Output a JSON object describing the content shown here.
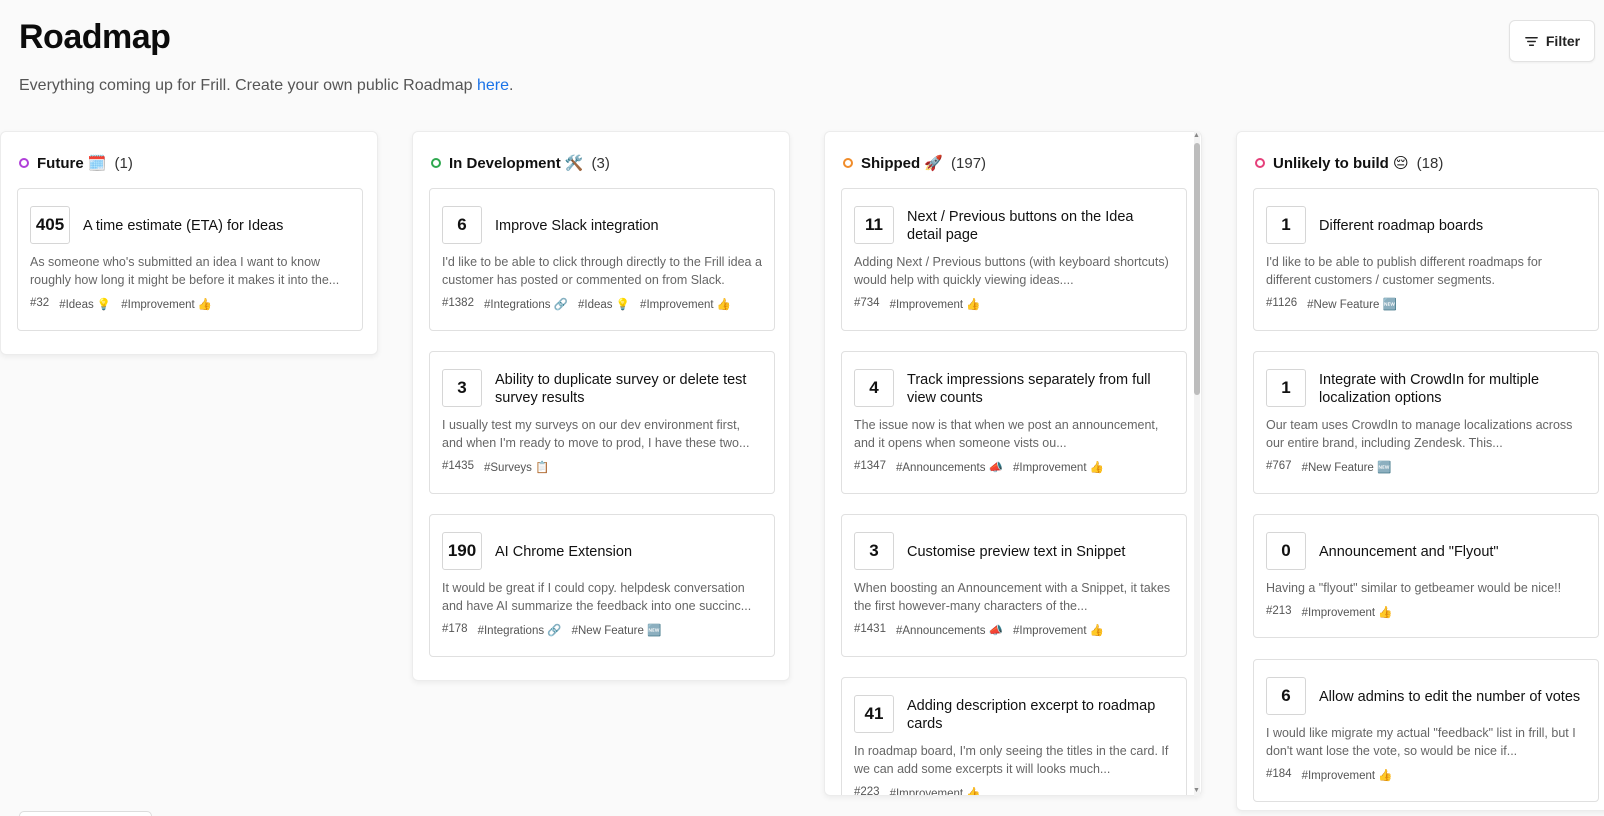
{
  "header": {
    "title": "Roadmap",
    "subtitle_prefix": "Everything coming up for Frill. Create your own public Roadmap ",
    "subtitle_link": "here",
    "subtitle_suffix": ".",
    "filter_label": "Filter"
  },
  "colors": {
    "future": "#b03fd9",
    "in_development": "#2fa84f",
    "shipped": "#f08c2a",
    "unlikely": "#e5407a",
    "link": "#1a73e8"
  },
  "columns": [
    {
      "title": "Future 🗓️",
      "count": "(1)",
      "cards": [
        {
          "votes": "405",
          "title": "A time estimate (ETA) for Ideas",
          "desc": "As someone who's submitted an idea I want to know roughly how long it might be before it makes it into the...",
          "tags": [
            "#32",
            "#Ideas 💡",
            "#Improvement 👍"
          ]
        }
      ]
    },
    {
      "title": "In Development 🛠️",
      "count": "(3)",
      "cards": [
        {
          "votes": "6",
          "title": "Improve Slack integration",
          "desc": "I'd like to be able to click through directly to the Frill idea a customer has posted or commented on from Slack.",
          "tags": [
            "#1382",
            "#Integrations 🔗",
            "#Ideas 💡",
            "#Improvement 👍"
          ]
        },
        {
          "votes": "3",
          "title": "Ability to duplicate survey or delete test survey results",
          "desc": "I usually test my surveys on our dev environment first, and when I'm ready to move to prod, I have these two...",
          "tags": [
            "#1435",
            "#Surveys 📋"
          ]
        },
        {
          "votes": "190",
          "title": "AI Chrome Extension",
          "desc": "It would be great if I could copy. helpdesk conversation and have AI summarize the feedback into one succinc...",
          "tags": [
            "#178",
            "#Integrations 🔗",
            "#New Feature 🆕"
          ]
        }
      ]
    },
    {
      "title": "Shipped 🚀",
      "count": "(197)",
      "cards": [
        {
          "votes": "11",
          "title": "Next / Previous buttons on the Idea detail page",
          "desc": "Adding Next / Previous buttons (with keyboard shortcuts) would help with quickly viewing ideas....",
          "tags": [
            "#734",
            "#Improvement 👍"
          ]
        },
        {
          "votes": "4",
          "title": "Track impressions separately from full view counts",
          "desc": "The issue now is that when we post an announcement, and it opens when someone vists ou...",
          "tags": [
            "#1347",
            "#Announcements 📣",
            "#Improvement 👍"
          ]
        },
        {
          "votes": "3",
          "title": "Customise preview text in Snippet",
          "desc": "When boosting an Announcement with a Snippet, it takes the first however-many characters of the...",
          "tags": [
            "#1431",
            "#Announcements 📣",
            "#Improvement 👍"
          ]
        },
        {
          "votes": "41",
          "title": "Adding description excerpt to roadmap cards",
          "desc": "In roadmap board, I'm only seeing the titles in the card. If we can add some excerpts it will looks much...",
          "tags": [
            "#223",
            "#Improvement 👍"
          ]
        }
      ]
    },
    {
      "title": "Unlikely to build 😔",
      "count": "(18)",
      "cards": [
        {
          "votes": "1",
          "title": "Different roadmap boards",
          "desc": "I'd like to be able to publish different roadmaps for different customers / customer segments.",
          "tags": [
            "#1126",
            "#New Feature 🆕"
          ]
        },
        {
          "votes": "1",
          "title": "Integrate with CrowdIn for multiple localization options",
          "desc": "Our team uses CrowdIn to manage localizations across our entire brand, including Zendesk. This...",
          "tags": [
            "#767",
            "#New Feature 🆕"
          ]
        },
        {
          "votes": "0",
          "title": "Announcement and \"Flyout\"",
          "desc": "Having a \"flyout\" similar to getbeamer would be nice!!",
          "tags": [
            "#213",
            "#Improvement 👍"
          ]
        },
        {
          "votes": "6",
          "title": "Allow admins to edit the number of votes",
          "desc": "I would like migrate my actual \"feedback\" list in frill, but I don't want lose the vote, so would be nice if...",
          "tags": [
            "#184",
            "#Improvement 👍"
          ]
        }
      ]
    }
  ]
}
